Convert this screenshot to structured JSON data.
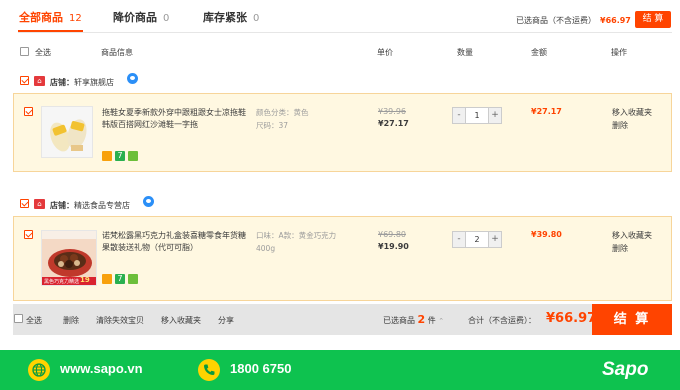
{
  "tabs": [
    {
      "label": "全部商品",
      "count": "12"
    },
    {
      "label": "降价商品",
      "count": "0"
    },
    {
      "label": "库存紧张",
      "count": "0"
    }
  ],
  "summary": {
    "label": "已选商品（不含运费）",
    "price": "¥66.97",
    "button": "结 算"
  },
  "header": {
    "select_all": "全选",
    "info": "商品信息",
    "unit_price": "单价",
    "quantity": "数量",
    "amount": "金额",
    "action": "操作"
  },
  "shops": [
    {
      "prefix": "店铺：",
      "name": "轩享旗舰店",
      "item": {
        "title": "拖鞋女夏季新款外穿中跟粗跟女士凉拖鞋韩版百搭网红沙滩鞋一字拖",
        "sku_color": "颜色分类：黄色",
        "sku_size": "尺码：37",
        "old_price": "¥39.96",
        "price": "¥27.17",
        "qty": "1",
        "amount": "¥27.17",
        "ops": [
          "移入收藏夹",
          "删除"
        ]
      }
    },
    {
      "prefix": "店铺：",
      "name": "精选食品专营店",
      "item": {
        "title": "诺梵松露黑巧克力礼盒装喜糖零食年货糖果散装送礼物（代可可脂）",
        "sku_flavor": "口味：A款：黄金巧克力",
        "sku_weight": "400g",
        "old_price": "¥69.80",
        "price": "¥19.90",
        "qty": "2",
        "amount": "¥39.80",
        "ops": [
          "移入收藏夹",
          "删除"
        ],
        "thumb_label": "黑色巧克力精选",
        "thumb_price": "19"
      }
    }
  ],
  "qty_minus": "-",
  "qty_plus": "+",
  "badges": {
    "colors": [
      "#f8a10c",
      "#2ab04f",
      "#6cbf3a"
    ],
    "seven": "7"
  },
  "bottom": {
    "select_all": "全选",
    "delete": "删除",
    "clear": "清除失效宝贝",
    "fav": "移入收藏夹",
    "share": "分享",
    "selected_prefix": "已选商品",
    "selected_count": "2",
    "selected_suffix": "件",
    "total_label": "合计（不含运费）：",
    "total": "¥66.97",
    "checkout": "结 算"
  },
  "footer": {
    "website": "www.sapo.vn",
    "phone": "1800 6750",
    "logo": "Sapo"
  },
  "colors": {
    "accent": "#ff4400",
    "green": "#0ec24f",
    "yellow": "#ffd300"
  }
}
